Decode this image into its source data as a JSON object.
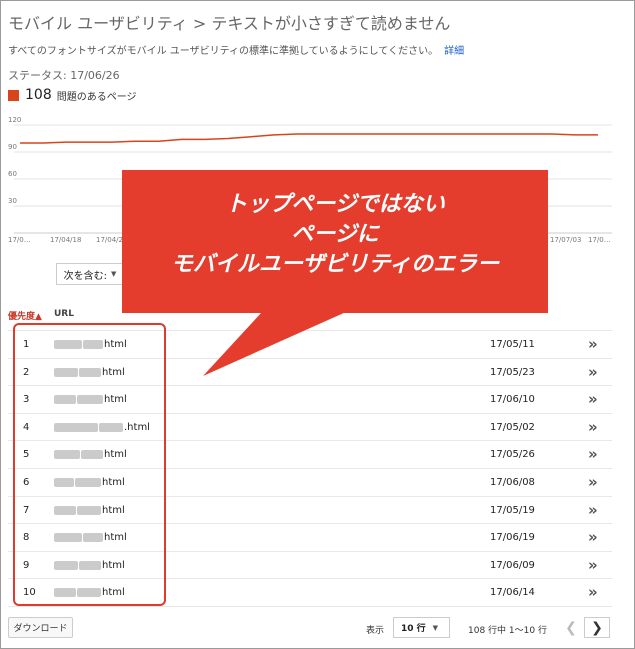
{
  "header": {
    "title": "モバイル ユーザビリティ > テキストが小さすぎて読めません",
    "description": "すべてのフォントサイズがモバイル ユーザビリティの標準に準拠しているようにしてください。",
    "details_link": "詳細",
    "status": "ステータス: 17/06/26"
  },
  "summary": {
    "count": "108",
    "label": "問題のあるページ",
    "color": "#d9441c"
  },
  "chart_data": {
    "type": "line",
    "x_ticks": [
      "17/0…",
      "17/04/18",
      "17/04/2…",
      "17/07/03",
      "17/0…"
    ],
    "y_ticks": [
      120,
      90,
      60,
      30
    ],
    "ylim": [
      0,
      120
    ],
    "series": [
      {
        "values": [
          100,
          100,
          101,
          101,
          101,
          102,
          102,
          104,
          104,
          105,
          107,
          109,
          110,
          110,
          110,
          110,
          110,
          110,
          110,
          110,
          110,
          110,
          110,
          110,
          109,
          109
        ]
      }
    ],
    "grid": true,
    "color": "#d9441c"
  },
  "filter": {
    "label": "次を含む:"
  },
  "table": {
    "headers": {
      "priority": "優先度▲",
      "url": "URL"
    },
    "rows": [
      {
        "num": "1",
        "url_suffix": "html",
        "date": "17/05/11"
      },
      {
        "num": "2",
        "url_suffix": "html",
        "date": "17/05/23"
      },
      {
        "num": "3",
        "url_suffix": "html",
        "date": "17/06/10"
      },
      {
        "num": "4",
        "url_suffix": ".html",
        "date": "17/05/02"
      },
      {
        "num": "5",
        "url_suffix": "html",
        "date": "17/05/26"
      },
      {
        "num": "6",
        "url_suffix": "html",
        "date": "17/06/08"
      },
      {
        "num": "7",
        "url_suffix": "html",
        "date": "17/05/19"
      },
      {
        "num": "8",
        "url_suffix": "html",
        "date": "17/06/19"
      },
      {
        "num": "9",
        "url_suffix": "html",
        "date": "17/06/09"
      },
      {
        "num": "10",
        "url_suffix": "html",
        "date": "17/06/14"
      }
    ],
    "row_action_icon": "double-chevron-right-icon"
  },
  "callout": {
    "line1": "トップページではない",
    "line2": "ページに",
    "line3": "モバイルユーザビリティのエラー",
    "color": "#e43d2e"
  },
  "footer": {
    "download": "ダウンロード",
    "show_label": "表示",
    "rows_per_page": "10 行",
    "range": "108 行中 1〜10 行",
    "prev_icon": "chevron-left-icon",
    "next_icon": "chevron-right-icon"
  }
}
